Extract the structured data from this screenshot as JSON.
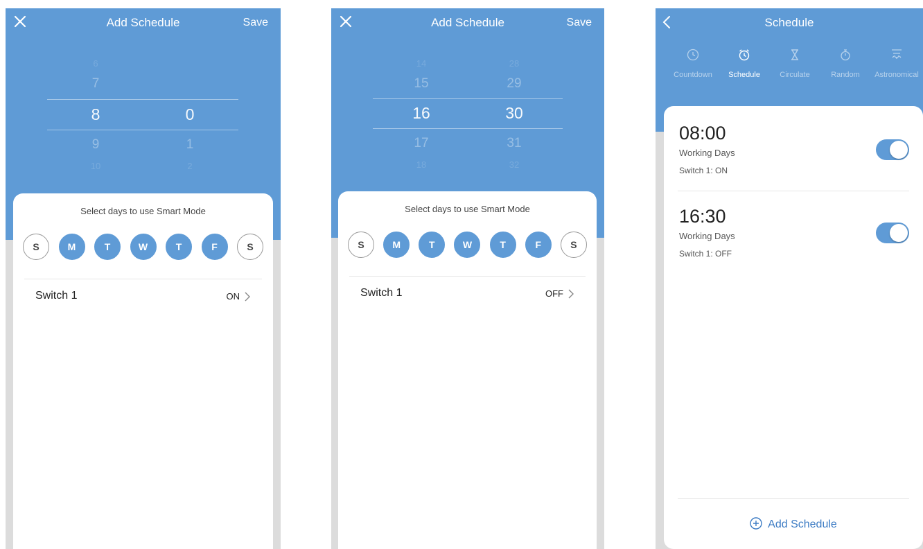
{
  "colors": {
    "accent": "#5f9bd6",
    "link": "#3d7cc4",
    "background": "#dcdcdc",
    "sheet": "#ffffff"
  },
  "screen1": {
    "title": "Add Schedule",
    "save_label": "Save",
    "close_icon": "close-icon",
    "picker": {
      "hours": [
        "6",
        "7",
        "8",
        "9",
        "10"
      ],
      "minutes": [
        "",
        "",
        "0",
        "1",
        "2"
      ]
    },
    "prompt": "Select days to use Smart Mode",
    "days": [
      {
        "label": "S",
        "on": false
      },
      {
        "label": "M",
        "on": true
      },
      {
        "label": "T",
        "on": true
      },
      {
        "label": "W",
        "on": true
      },
      {
        "label": "T",
        "on": true
      },
      {
        "label": "F",
        "on": true
      },
      {
        "label": "S",
        "on": false
      }
    ],
    "switch_label": "Switch 1",
    "switch_value": "ON"
  },
  "screen2": {
    "title": "Add Schedule",
    "save_label": "Save",
    "close_icon": "close-icon",
    "picker": {
      "hours": [
        "14",
        "15",
        "16",
        "17",
        "18"
      ],
      "minutes": [
        "28",
        "29",
        "30",
        "31",
        "32"
      ]
    },
    "prompt": "Select days to use Smart Mode",
    "days": [
      {
        "label": "S",
        "on": false
      },
      {
        "label": "M",
        "on": true
      },
      {
        "label": "T",
        "on": true
      },
      {
        "label": "W",
        "on": true
      },
      {
        "label": "T",
        "on": true
      },
      {
        "label": "F",
        "on": true
      },
      {
        "label": "S",
        "on": false
      }
    ],
    "switch_label": "Switch 1",
    "switch_value": "OFF"
  },
  "screen3": {
    "title": "Schedule",
    "back_icon": "chevron-left-icon",
    "tabs": [
      {
        "label": "Countdown",
        "icon": "clock-icon",
        "active": false
      },
      {
        "label": "Schedule",
        "icon": "alarm-clock-icon",
        "active": true
      },
      {
        "label": "Circulate",
        "icon": "hourglass-icon",
        "active": false
      },
      {
        "label": "Random",
        "icon": "stopwatch-icon",
        "active": false
      },
      {
        "label": "Astronomical",
        "icon": "sunrise-icon",
        "active": false
      }
    ],
    "schedules": [
      {
        "time": "08:00",
        "days": "Working Days",
        "action": "Switch 1: ON",
        "enabled": true
      },
      {
        "time": "16:30",
        "days": "Working Days",
        "action": "Switch 1: OFF",
        "enabled": true
      }
    ],
    "add_label": "Add Schedule",
    "add_icon": "plus-circle-icon"
  }
}
